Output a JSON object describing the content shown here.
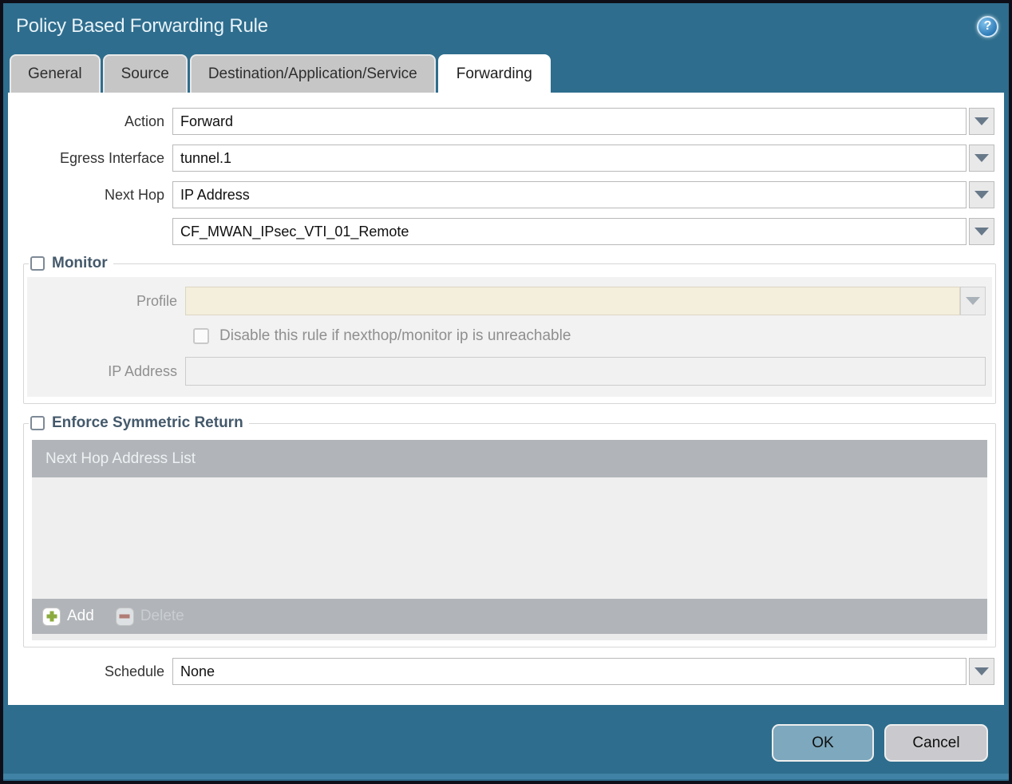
{
  "dialog": {
    "title": "Policy Based Forwarding Rule"
  },
  "tabs": [
    {
      "label": "General",
      "active": false
    },
    {
      "label": "Source",
      "active": false
    },
    {
      "label": "Destination/Application/Service",
      "active": false
    },
    {
      "label": "Forwarding",
      "active": true
    }
  ],
  "form": {
    "action": {
      "label": "Action",
      "value": "Forward"
    },
    "egress_interface": {
      "label": "Egress Interface",
      "value": "tunnel.1"
    },
    "next_hop": {
      "label": "Next Hop",
      "value": "IP Address"
    },
    "next_hop_address": {
      "value": "CF_MWAN_IPsec_VTI_01_Remote"
    },
    "schedule": {
      "label": "Schedule",
      "value": "None"
    }
  },
  "monitor": {
    "legend": "Monitor",
    "checked": false,
    "profile": {
      "label": "Profile",
      "value": ""
    },
    "disable_rule": {
      "label": "Disable this rule if nexthop/monitor ip is unreachable",
      "checked": false
    },
    "ip_address": {
      "label": "IP Address",
      "value": ""
    }
  },
  "symmetric_return": {
    "legend": "Enforce Symmetric Return",
    "checked": false,
    "table": {
      "header": "Next Hop Address List",
      "rows": []
    },
    "add_label": "Add",
    "delete_label": "Delete"
  },
  "footer": {
    "ok_label": "OK",
    "cancel_label": "Cancel"
  },
  "icons": {
    "help_icon": "?",
    "dropdown_arrow_icon": "triangle-down",
    "add_icon": "green-plus",
    "delete_icon": "red-minus"
  },
  "colors": {
    "frame_teal": "#2e6d8d",
    "title_text": "#e9f3f9",
    "tab_inactive": "#c6c6c6",
    "tab_active": "#ffffff",
    "legend_text": "#44596b",
    "panel_gray": "#f2f2f2",
    "profile_field_cream": "#f4eedc",
    "table_bar_gray": "#b1b5b9",
    "table_body_gray": "#efefef",
    "ok_button": "#7da8bd",
    "cancel_button": "#cacace",
    "add_plus_green": "#8cab3f",
    "delete_minus_red": "#b0695f"
  }
}
